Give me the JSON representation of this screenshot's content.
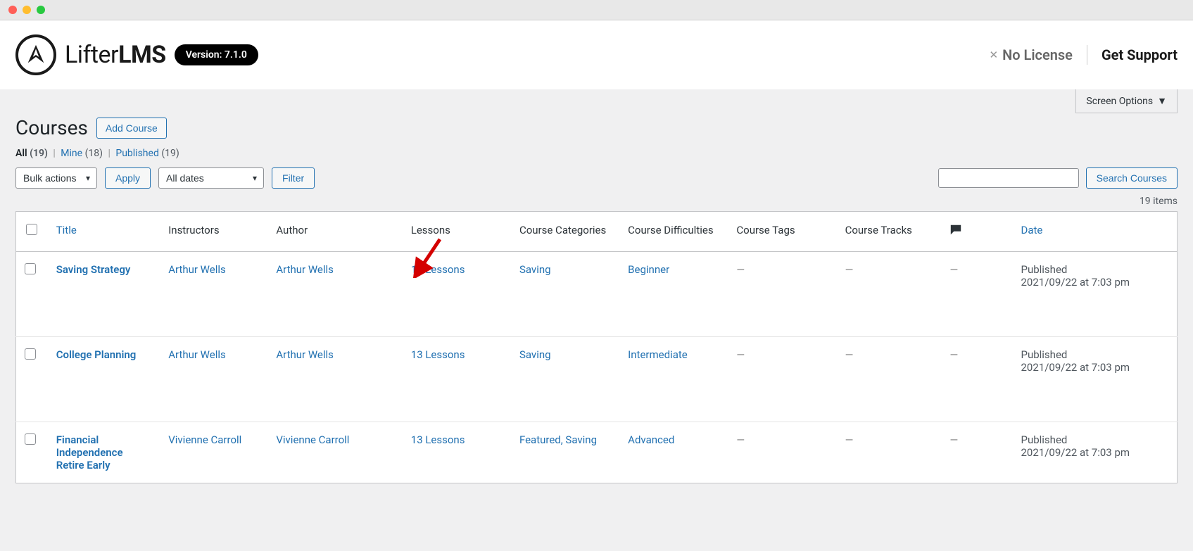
{
  "topbar": {
    "logo_text_pre": "Lifter",
    "logo_text_bold": "LMS",
    "version_label": "Version: 7.1.0",
    "no_license": "No License",
    "get_support": "Get Support"
  },
  "admin": {
    "screen_options": "Screen Options",
    "page_title": "Courses",
    "add_course": "Add Course",
    "filters": [
      {
        "label": "All",
        "count": "(19)",
        "current": true
      },
      {
        "label": "Mine",
        "count": "(18)",
        "current": false
      },
      {
        "label": "Published",
        "count": "(19)",
        "current": false
      }
    ],
    "bulk_actions": "Bulk actions",
    "apply": "Apply",
    "all_dates": "All dates",
    "filter": "Filter",
    "search_button": "Search Courses",
    "items_count": "19 items"
  },
  "table": {
    "columns": {
      "title": "Title",
      "instructors": "Instructors",
      "author": "Author",
      "lessons": "Lessons",
      "categories": "Course Categories",
      "difficulties": "Course Difficulties",
      "tags": "Course Tags",
      "tracks": "Course Tracks",
      "date": "Date"
    },
    "rows": [
      {
        "title": "Saving Strategy",
        "instructors": "Arthur Wells",
        "author": "Arthur Wells",
        "lessons": "13 Lessons",
        "categories": "Saving",
        "difficulties": "Beginner",
        "tags": "—",
        "tracks": "—",
        "comments": "—",
        "date_status": "Published",
        "date_time": "2021/09/22 at 7:03 pm"
      },
      {
        "title": "College Planning",
        "instructors": "Arthur Wells",
        "author": "Arthur Wells",
        "lessons": "13 Lessons",
        "categories": "Saving",
        "difficulties": "Intermediate",
        "tags": "—",
        "tracks": "—",
        "comments": "—",
        "date_status": "Published",
        "date_time": "2021/09/22 at 7:03 pm"
      },
      {
        "title": "Financial Independence Retire Early",
        "instructors": "Vivienne Carroll",
        "author": "Vivienne Carroll",
        "lessons": "13 Lessons",
        "categories": "Featured, Saving",
        "difficulties": "Advanced",
        "tags": "—",
        "tracks": "—",
        "comments": "—",
        "date_status": "Published",
        "date_time": "2021/09/22 at 7:03 pm"
      }
    ]
  }
}
